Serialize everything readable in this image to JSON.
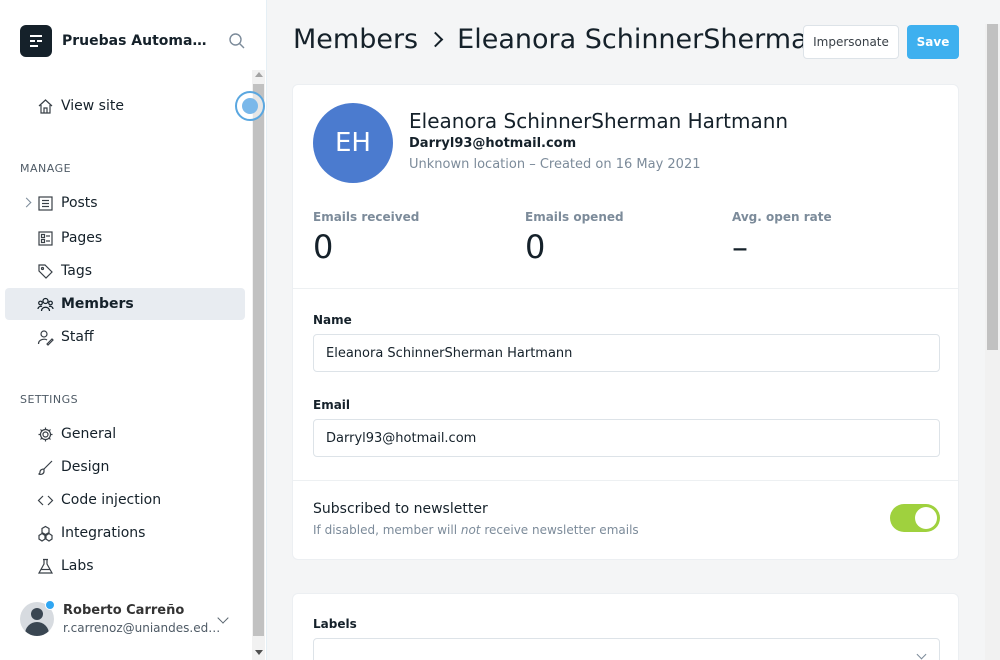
{
  "brand": {
    "name": "Pruebas Automatización"
  },
  "nav": {
    "view_site": "View site",
    "manage_title": "MANAGE",
    "posts": "Posts",
    "pages": "Pages",
    "tags": "Tags",
    "members": "Members",
    "staff": "Staff",
    "settings_title": "SETTINGS",
    "general": "General",
    "design": "Design",
    "code_injection": "Code injection",
    "integrations": "Integrations",
    "labs": "Labs"
  },
  "user": {
    "name": "Roberto Carreño",
    "email": "r.carrenoz@uniandes.edu.co"
  },
  "header": {
    "breadcrumb_parent": "Members",
    "breadcrumb_current": "Eleanora SchinnerSherman",
    "impersonate_label": "Impersonate",
    "save_label": "Save"
  },
  "member": {
    "initials": "EH",
    "full_name": "Eleanora SchinnerSherman Hartmann",
    "email": "Darryl93@hotmail.com",
    "meta_prefix": "Unknown location – Created on 16 May 2021"
  },
  "stats": [
    {
      "label": "Emails received",
      "value": "0"
    },
    {
      "label": "Emails opened",
      "value": "0"
    },
    {
      "label": "Avg. open rate",
      "value": "–"
    }
  ],
  "form": {
    "name_label": "Name",
    "name_value": "Eleanora SchinnerSherman Hartmann",
    "email_label": "Email",
    "email_value": "Darryl93@hotmail.com",
    "newsletter_title": "Subscribed to newsletter",
    "newsletter_desc_before": "If disabled, member will ",
    "newsletter_desc_em": "not",
    "newsletter_desc_after": " receive newsletter emails",
    "newsletter_enabled": true,
    "labels_label": "Labels"
  },
  "colors": {
    "accent": "#3eb0ef",
    "toggle_on": "#9fd13e",
    "avatar_bg": "#4b7bcf"
  }
}
